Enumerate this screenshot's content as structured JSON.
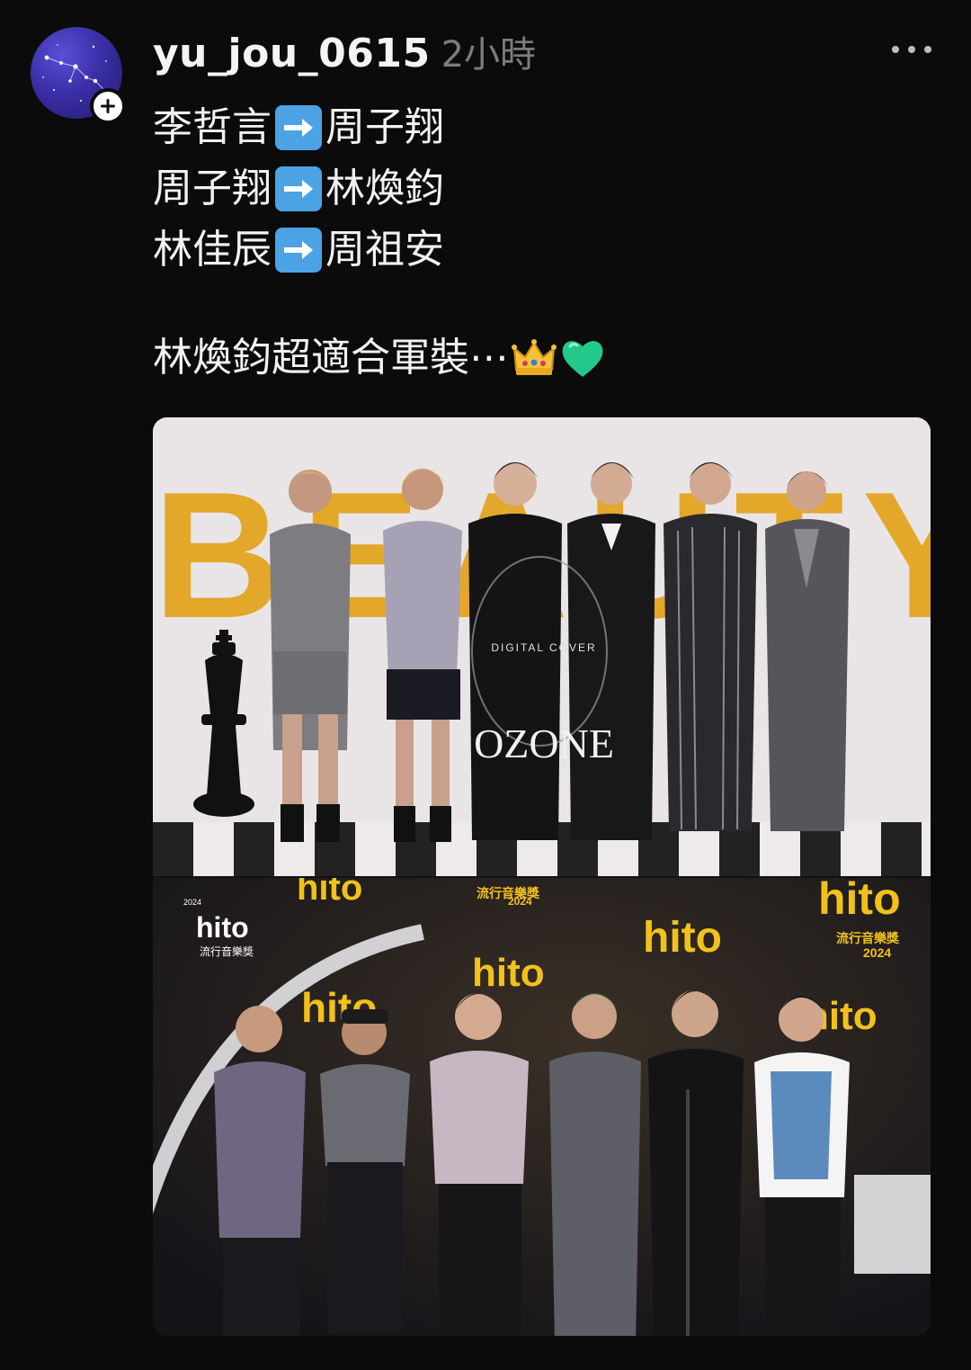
{
  "post": {
    "username": "yu_jou_0615",
    "timestamp": "2小時",
    "lines": [
      {
        "before": "李哲言",
        "after": "周子翔"
      },
      {
        "before": "周子翔",
        "after": "林煥鈞"
      },
      {
        "before": "林佳辰",
        "after": "周祖安"
      }
    ],
    "caption": "林煥鈞超適合軍裝⋯",
    "emojis": [
      "crown-emoji",
      "green-heart-emoji"
    ]
  },
  "images": {
    "top": {
      "backdrop_text": "BEAUTY",
      "cover_label": "DIGITAL COVER",
      "magazine": "OZONE",
      "colors": {
        "backdrop": "#e9e5e6",
        "brand_yellow": "#e3a72a"
      }
    },
    "bottom": {
      "event_logo": "hito",
      "event_year": "2024",
      "event_subtitle": "流行音樂獎",
      "colors": {
        "stage": "#1b1a1e",
        "gold": "#f2c11a"
      }
    }
  }
}
